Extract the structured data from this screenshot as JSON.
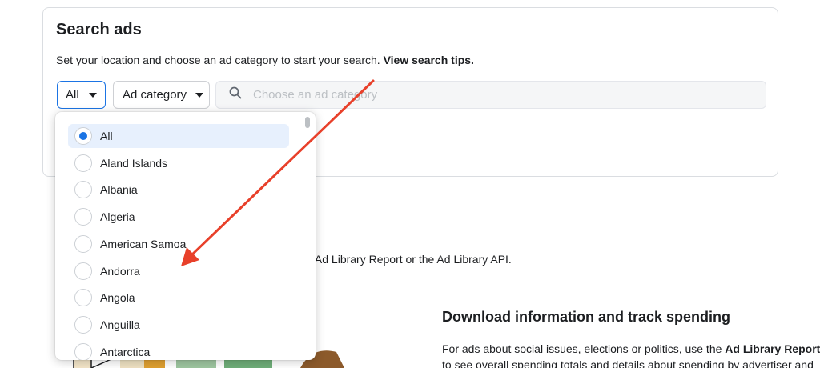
{
  "card": {
    "title": "Search ads",
    "desc_prefix": "Set your location and choose an ad category to start your search. ",
    "desc_link": "View search tips."
  },
  "country_dropdown": {
    "value": "All"
  },
  "category_dropdown": {
    "value": "Ad category"
  },
  "search": {
    "placeholder": "Choose an ad category"
  },
  "background": {
    "text1": "e Ad Library Report or the Ad Library API.",
    "heading": "Download information and track spending",
    "para_line1_prefix": "For ads about social issues, elections or politics, use the ",
    "para_line1_bold": "Ad Library Report",
    "para_line2": "to see overall spending totals and details about spending by advertiser and"
  },
  "country_options": [
    {
      "label": "All",
      "selected": true
    },
    {
      "label": "Aland Islands",
      "selected": false
    },
    {
      "label": "Albania",
      "selected": false
    },
    {
      "label": "Algeria",
      "selected": false
    },
    {
      "label": "American Samoa",
      "selected": false
    },
    {
      "label": "Andorra",
      "selected": false
    },
    {
      "label": "Angola",
      "selected": false
    },
    {
      "label": "Anguilla",
      "selected": false
    },
    {
      "label": "Antarctica",
      "selected": false
    }
  ],
  "colors": {
    "accent": "#1b74e4",
    "annotation_arrow": "#e8402a",
    "selected_bg": "#e7f0fd"
  },
  "icons": {
    "search": "search-icon",
    "caret": "caret-down-icon"
  }
}
